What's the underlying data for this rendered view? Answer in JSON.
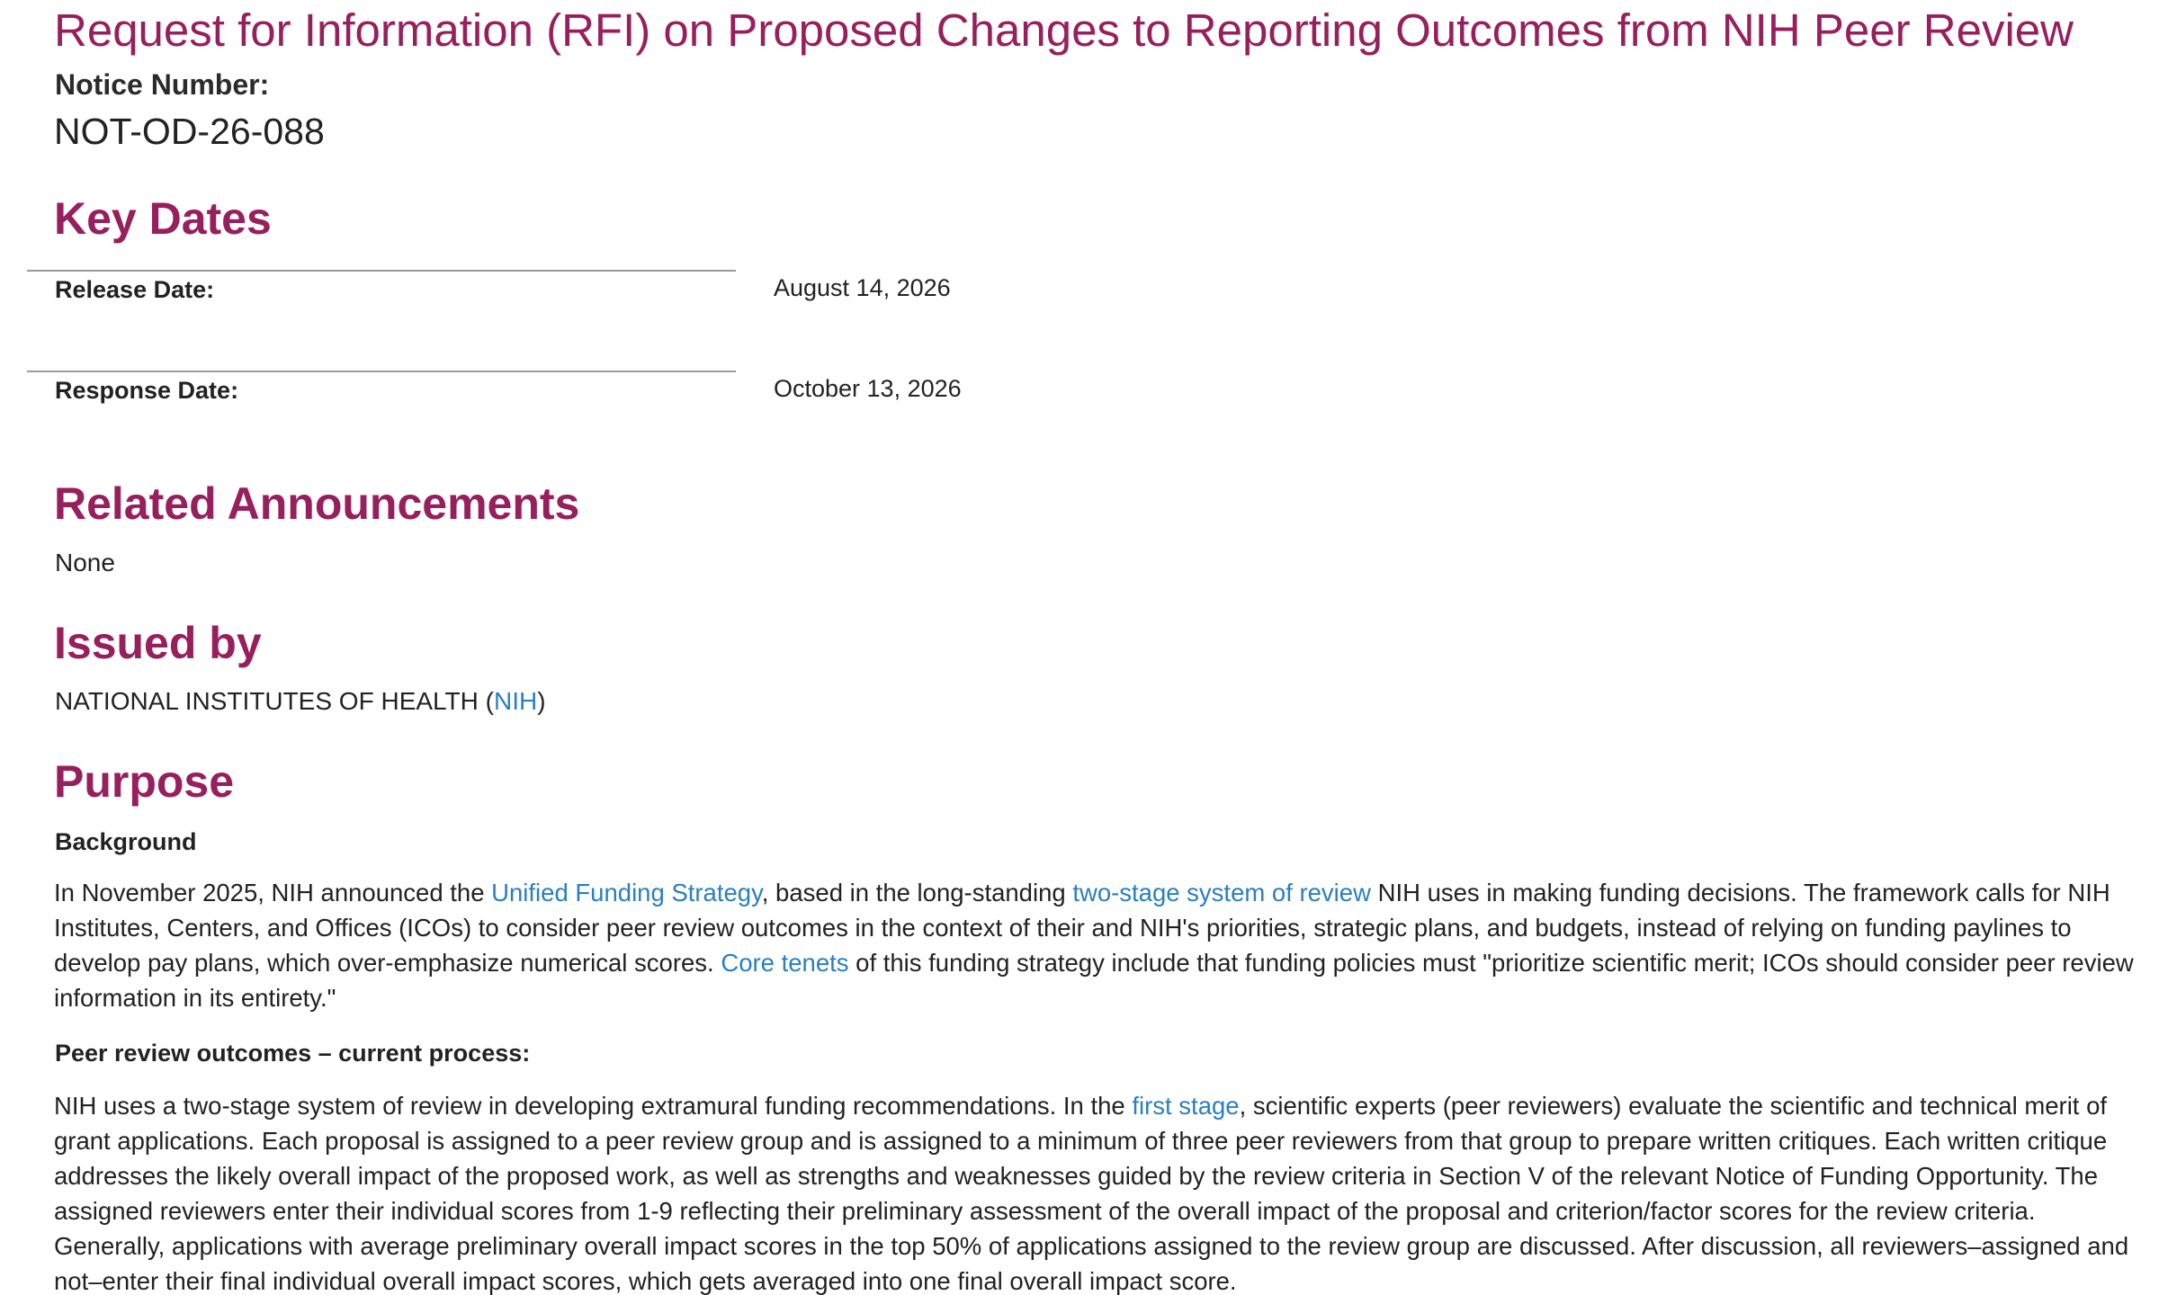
{
  "title": "Request for Information (RFI) on Proposed Changes to Reporting Outcomes from NIH Peer Review",
  "notice": {
    "label": "Notice Number:",
    "number": "NOT-OD-26-088"
  },
  "key_dates": {
    "heading": "Key Dates",
    "rows": [
      {
        "label": "Release Date:",
        "value": "August 14, 2026"
      },
      {
        "label": "Response Date:",
        "value": "October 13, 2026"
      }
    ]
  },
  "related": {
    "heading": "Related Announcements",
    "value": "None"
  },
  "issued_by": {
    "heading": "Issued by",
    "prefix": "NATIONAL INSTITUTES OF HEALTH (",
    "link": "NIH",
    "suffix": ")"
  },
  "purpose": {
    "heading": "Purpose",
    "background": {
      "subheading": "Background",
      "p1_a": "In November 2025, NIH announced the ",
      "p1_link1": "Unified Funding Strategy",
      "p1_b": ", based in the long-standing ",
      "p1_link2": "two-stage system of review",
      "p1_c": " NIH uses in making funding decisions. The framework calls for NIH Institutes, Centers, and Offices (ICOs) to consider peer review outcomes in the context of their and NIH's priorities, strategic plans, and budgets, instead of relying on funding paylines to develop pay plans, which over-emphasize numerical scores. ",
      "p1_link3": "Core tenets",
      "p1_d": " of this funding strategy include that funding policies must \"prioritize scientific merit; ICOs should consider peer review information in its entirety.\""
    },
    "current_process": {
      "subheading": "Peer review outcomes – current process:",
      "p2_a": "NIH uses a two-stage system of review in developing extramural funding recommendations. In the ",
      "p2_link": "first stage",
      "p2_b": ", scientific experts (peer reviewers) evaluate the scientific and technical merit of grant applications. Each proposal is assigned to a peer review group and is assigned to a minimum of three peer reviewers from that group to prepare written critiques. Each written critique addresses the likely overall impact of the proposed work, as well as strengths and weaknesses guided by the review criteria in Section V of the relevant Notice of Funding Opportunity. The assigned reviewers enter their individual scores from 1-9 reflecting their preliminary assessment of the overall impact of the proposal and criterion/factor scores for the review criteria. Generally, applications with average preliminary overall impact scores in the top 50% of applications assigned to the review group are discussed. After discussion, all reviewers–assigned and not–enter their final individual overall impact scores, which gets averaged into one final overall impact score."
    }
  },
  "colors": {
    "heading": "#981f5d",
    "link": "#2a7fc1",
    "text": "#222222",
    "rule": "#9a9a9a"
  }
}
